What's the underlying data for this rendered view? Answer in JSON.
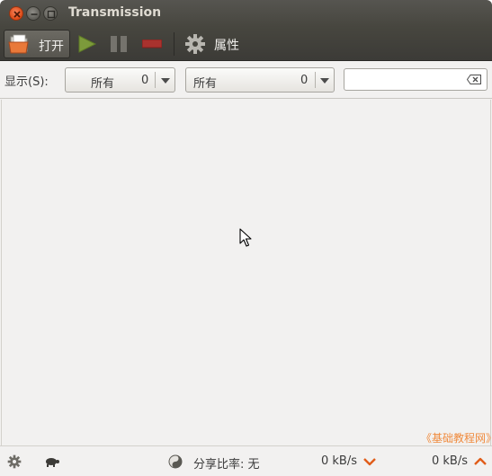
{
  "window": {
    "title": "Transmission"
  },
  "toolbar": {
    "open_label": "打开",
    "properties_label": "属性",
    "icons": [
      "open-folder-icon",
      "start-icon",
      "pause-icon",
      "remove-icon",
      "gear-icon"
    ]
  },
  "filterbar": {
    "show_label": "显示(S):",
    "activity_filter": {
      "selected": "所有",
      "count": "0"
    },
    "tracker_filter": {
      "selected": "所有",
      "count": "0"
    },
    "search": {
      "value": "",
      "placeholder": ""
    }
  },
  "watermark": "《基础教程网》",
  "statusbar": {
    "ratio_label": "分享比率: 无",
    "download_speed": "0 kB/s",
    "upload_speed": "0 kB/s",
    "accent_color": "#e05d1a"
  }
}
